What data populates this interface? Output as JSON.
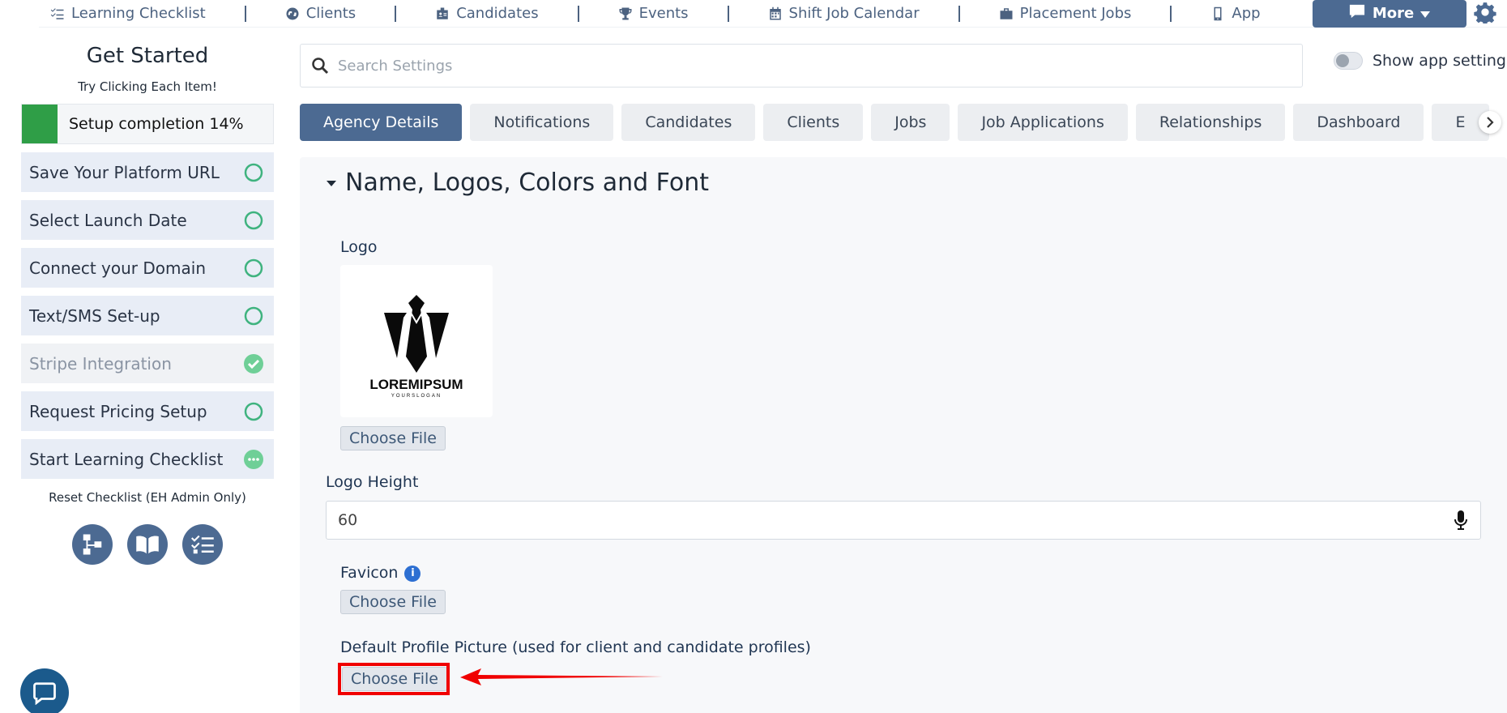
{
  "nav": {
    "items": [
      {
        "label": "Learning Checklist",
        "icon": "checklist-icon"
      },
      {
        "label": "Clients",
        "icon": "globe-icon"
      },
      {
        "label": "Candidates",
        "icon": "id-badge-icon"
      },
      {
        "label": "Events",
        "icon": "trophy-icon"
      },
      {
        "label": "Shift Job Calendar",
        "icon": "calendar-icon"
      },
      {
        "label": "Placement Jobs",
        "icon": "briefcase-icon"
      },
      {
        "label": "App",
        "icon": "phone-icon"
      }
    ],
    "more_label": "More",
    "settings_icon": "gear-icon"
  },
  "get_started": {
    "title": "Get Started",
    "subtitle": "Try Clicking Each Item!",
    "progress_label": "Setup completion 14%",
    "progress_value": 0.14,
    "tasks": [
      {
        "label": "Save Your Platform URL",
        "status": "pending"
      },
      {
        "label": "Select Launch Date",
        "status": "pending"
      },
      {
        "label": "Connect your Domain",
        "status": "pending"
      },
      {
        "label": "Text/SMS Set-up",
        "status": "pending"
      },
      {
        "label": "Stripe Integration",
        "status": "done"
      },
      {
        "label": "Request Pricing Setup",
        "status": "pending"
      },
      {
        "label": "Start Learning Checklist",
        "status": "in-progress"
      }
    ],
    "reset_label": "Reset Checklist (EH Admin Only)"
  },
  "search": {
    "placeholder": "Search Settings",
    "show_app_settings_label": "Show app settings"
  },
  "tabs": [
    {
      "label": "Agency Details",
      "active": true
    },
    {
      "label": "Notifications",
      "active": false
    },
    {
      "label": "Candidates",
      "active": false
    },
    {
      "label": "Clients",
      "active": false
    },
    {
      "label": "Jobs",
      "active": false
    },
    {
      "label": "Job Applications",
      "active": false
    },
    {
      "label": "Relationships",
      "active": false
    },
    {
      "label": "Dashboard",
      "active": false
    },
    {
      "label": "E",
      "active": false
    }
  ],
  "section": {
    "title": "Name, Logos, Colors and Font",
    "logo_label": "Logo",
    "logo_text": "LOREMIPSUM",
    "logo_slogan": "YOURSLOGAN",
    "choose_file_label": "Choose File",
    "logo_height_label": "Logo Height",
    "logo_height_value": "60",
    "favicon_label": "Favicon",
    "default_profile_label": "Default Profile Picture (used for client and candidate profiles)"
  },
  "colors": {
    "accent": "#4c6a92",
    "success": "#2f9e47",
    "highlight": "#f00000"
  }
}
